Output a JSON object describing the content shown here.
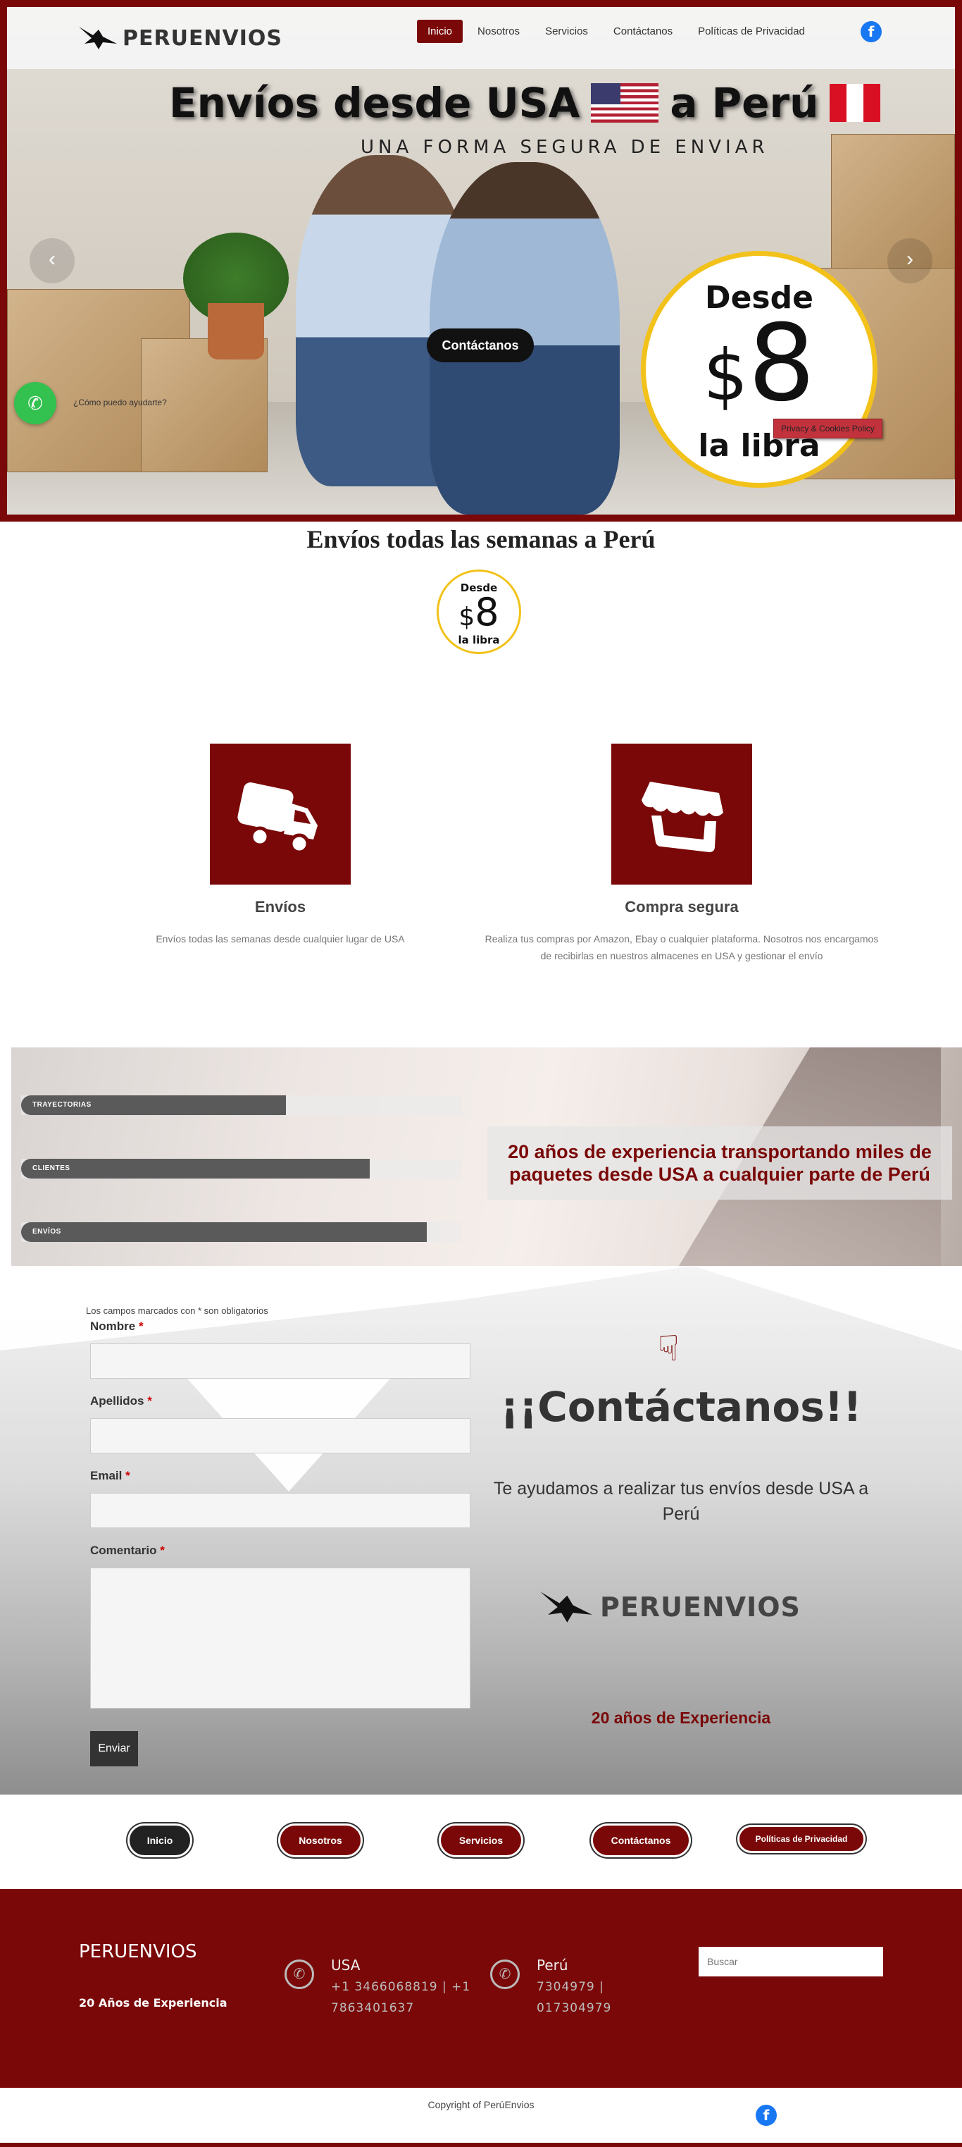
{
  "brand": {
    "name": "PERUENVIOS"
  },
  "nav": {
    "items": [
      {
        "label": "Inicio",
        "active": true
      },
      {
        "label": "Nosotros"
      },
      {
        "label": "Servicios"
      },
      {
        "label": "Contáctanos"
      },
      {
        "label": "Políticas de Privacidad"
      }
    ]
  },
  "hero": {
    "title_part1": "Envíos desde USA",
    "title_part2": "a Perú",
    "subtitle": "UNA FORMA SEGURA DE ENVIAR",
    "button": "Contáctanos",
    "badge": {
      "top": "Desde",
      "price_symbol": "$",
      "price": "8",
      "bottom": "la libra"
    },
    "prev_arrow": "‹",
    "next_arrow": "›"
  },
  "cookie": {
    "label": "Privacy & Cookies Policy"
  },
  "whatsapp": {
    "prompt": "¿Cómo puedo ayudarte?"
  },
  "weekly": {
    "heading": "Envíos todas las semanas a Perú",
    "badge": {
      "top": "Desde",
      "price_symbol": "$",
      "price": "8",
      "bottom": "la libra"
    }
  },
  "features": [
    {
      "title": "Envíos",
      "desc": "Envíos todas las semanas desde cualquier lugar de USA"
    },
    {
      "title": "Compra segura",
      "desc": "Realiza tus compras por Amazon, Ebay o cualquier plataforma. Nosotros nos encargamos de recibirlas en nuestros almacenes en USA y gestionar el envío"
    }
  ],
  "stats": {
    "bars": [
      {
        "label": "TRAYECTORIAS",
        "percent": 60
      },
      {
        "label": "CLIENTES",
        "percent": 79
      },
      {
        "label": "ENVÍOS",
        "percent": 92
      }
    ],
    "note": "20 años de experiencia transportando miles de paquetes desde USA a cualquier parte de Perú"
  },
  "form": {
    "required_note": "Los campos marcados con * son obligatorios",
    "fields": [
      {
        "label": "Nombre",
        "value": ""
      },
      {
        "label": "Apellidos",
        "value": ""
      },
      {
        "label": "Email",
        "value": ""
      },
      {
        "label": "Comentario",
        "value": ""
      }
    ],
    "required_mark": "*",
    "submit": "Enviar"
  },
  "contact": {
    "title": "¡¡Contáctanos!!",
    "subtitle": "Te ayudamos a realizar tus envíos desde USA a Perú",
    "experience": "20 años de Experiencia"
  },
  "footer_nav": [
    "Inicio",
    "Nosotros",
    "Servicios",
    "Contáctanos",
    "Políticas de Privacidad"
  ],
  "footer": {
    "brand": "PERUENVIOS",
    "experience": "20 Años de Experiencia",
    "usa": {
      "country": "USA",
      "phones": "+1 3466068819 | +1 7863401637"
    },
    "peru": {
      "country": "Perú",
      "phones": "7304979 | 017304979"
    },
    "search_placeholder": "Buscar",
    "copyright": "Copyright of PerúEnvios"
  },
  "colors": {
    "brand": "#7a0808",
    "facebook": "#1877f2",
    "whatsapp": "#33c14f",
    "badge_ring": "#f2c21b"
  }
}
